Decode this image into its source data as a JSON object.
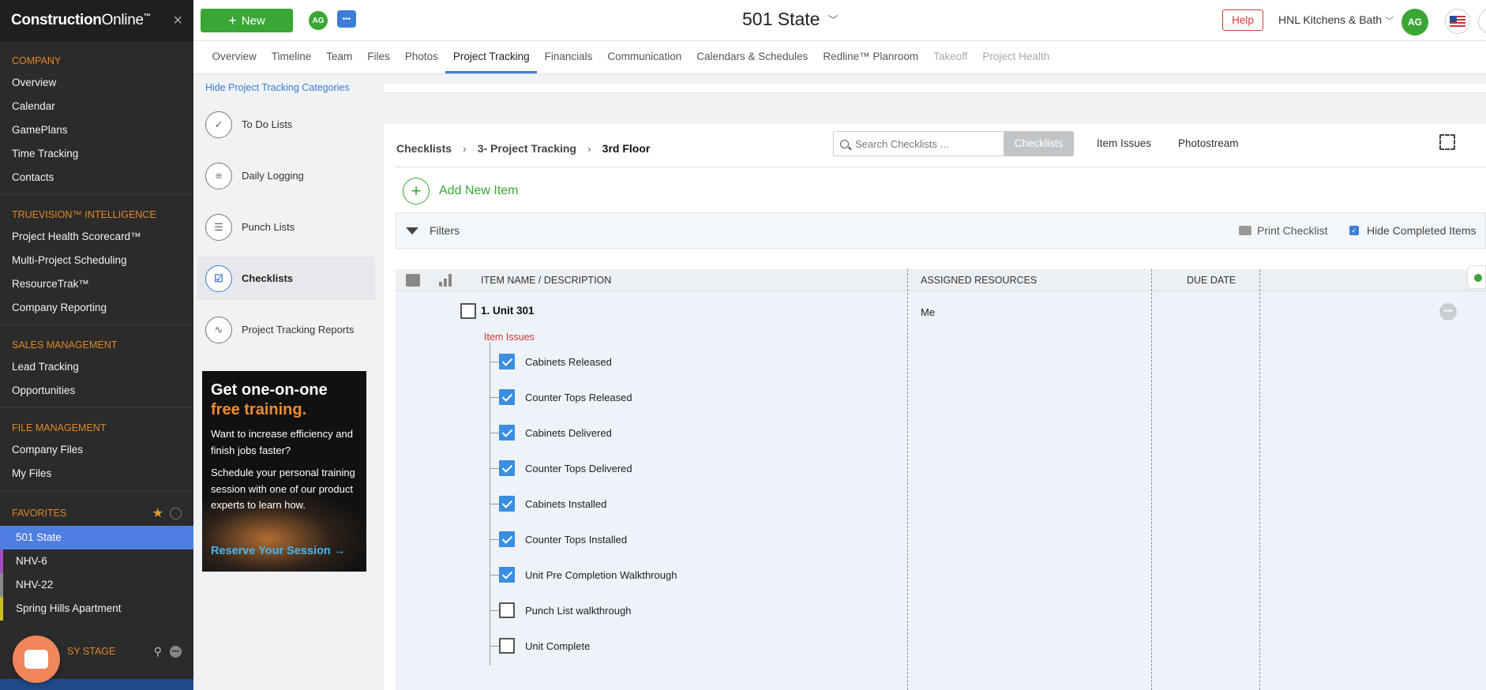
{
  "sidebar": {
    "brand_main": "Construction",
    "brand_rest": "Online",
    "brand_tm": "™",
    "close_glyph": "×",
    "sections": [
      {
        "heading": "COMPANY",
        "items": [
          "Overview",
          "Calendar",
          "GamePlans",
          "Time Tracking",
          "Contacts"
        ]
      },
      {
        "heading": "TRUEVISION™ INTELLIGENCE",
        "items": [
          "Project Health Scorecard™",
          "Multi-Project Scheduling",
          "ResourceTrak™",
          "Company Reporting"
        ]
      },
      {
        "heading": "SALES MANAGEMENT",
        "items": [
          "Lead Tracking",
          "Opportunities"
        ]
      },
      {
        "heading": "FILE MANAGEMENT",
        "items": [
          "Company Files",
          "My Files"
        ]
      }
    ],
    "favorites_heading": "FAVORITES",
    "favorites": [
      {
        "label": "501 State",
        "color": "#4e7ee0",
        "active": true
      },
      {
        "label": "NHV-6",
        "color": "#a04fc0",
        "active": false
      },
      {
        "label": "NHV-22",
        "color": "#8a8a8a",
        "active": false
      },
      {
        "label": "Spring Hills Apartment",
        "color": "#c8c020",
        "active": false
      }
    ],
    "bottom_label": "SY STAGE"
  },
  "topbar": {
    "new_label": "New",
    "user_initials": "AG",
    "project_title": "501 State",
    "help_label": "Help",
    "company_name": "HNL Kitchens & Bath",
    "avatar_initials": "AG"
  },
  "tabs": [
    {
      "label": "Overview",
      "state": "normal"
    },
    {
      "label": "Timeline",
      "state": "normal"
    },
    {
      "label": "Team",
      "state": "normal"
    },
    {
      "label": "Files",
      "state": "normal"
    },
    {
      "label": "Photos",
      "state": "normal"
    },
    {
      "label": "Project Tracking",
      "state": "active"
    },
    {
      "label": "Financials",
      "state": "normal"
    },
    {
      "label": "Communication",
      "state": "normal"
    },
    {
      "label": "Calendars & Schedules",
      "state": "normal"
    },
    {
      "label": "Redline™ Planroom",
      "state": "normal"
    },
    {
      "label": "Takeoff",
      "state": "disabled"
    },
    {
      "label": "Project Health",
      "state": "disabled"
    }
  ],
  "hide_categories_label": "Hide Project Tracking Categories",
  "project_nav": [
    {
      "label": "To Do Lists",
      "icon": "todo-list-icon",
      "glyph": "✓",
      "active": false
    },
    {
      "label": "Daily Logging",
      "icon": "daily-log-icon",
      "glyph": "≡",
      "active": false
    },
    {
      "label": "Punch Lists",
      "icon": "punch-list-icon",
      "glyph": "☰",
      "active": false
    },
    {
      "label": "Checklists",
      "icon": "checklist-icon",
      "glyph": "☑",
      "active": true
    },
    {
      "label": "Project Tracking Reports",
      "icon": "reports-icon",
      "glyph": "∿",
      "active": false
    }
  ],
  "ad": {
    "title_line1": "Get one-on-one",
    "title_line2": "free training.",
    "body1": "Want to increase efficiency and finish jobs faster?",
    "body2": "Schedule your personal training session with one of our product experts to learn how.",
    "cta": "Reserve Your Session →"
  },
  "breadcrumb": [
    "Checklists",
    "3- Project Tracking",
    "3rd Floor"
  ],
  "breadcrumb_sep": "›",
  "search": {
    "placeholder": "Search Checklists ..."
  },
  "views": [
    "Checklists",
    "Item Issues",
    "Photostream"
  ],
  "add_new_item": "Add New Item",
  "filters": {
    "label": "Filters",
    "print_label": "Print Checklist",
    "hide_completed_label": "Hide Completed Items",
    "hide_completed_checked": true
  },
  "table": {
    "columns": [
      "ITEM NAME / DESCRIPTION",
      "ASSIGNED RESOURCES",
      "DUE DATE"
    ],
    "item": {
      "name": "1. Unit 301",
      "assigned": "Me",
      "checked": false
    },
    "issues_label": "Item Issues",
    "subitems": [
      {
        "label": "Cabinets Released",
        "checked": true
      },
      {
        "label": "Counter Tops Released",
        "checked": true
      },
      {
        "label": "Cabinets Delivered",
        "checked": true
      },
      {
        "label": "Counter Tops Delivered",
        "checked": true
      },
      {
        "label": "Cabinets Installed",
        "checked": true
      },
      {
        "label": "Counter Tops Installed",
        "checked": true
      },
      {
        "label": "Unit Pre Completion Walkthrough",
        "checked": true
      },
      {
        "label": "Punch List walkthrough",
        "checked": false
      },
      {
        "label": "Unit Complete",
        "checked": false
      }
    ]
  }
}
